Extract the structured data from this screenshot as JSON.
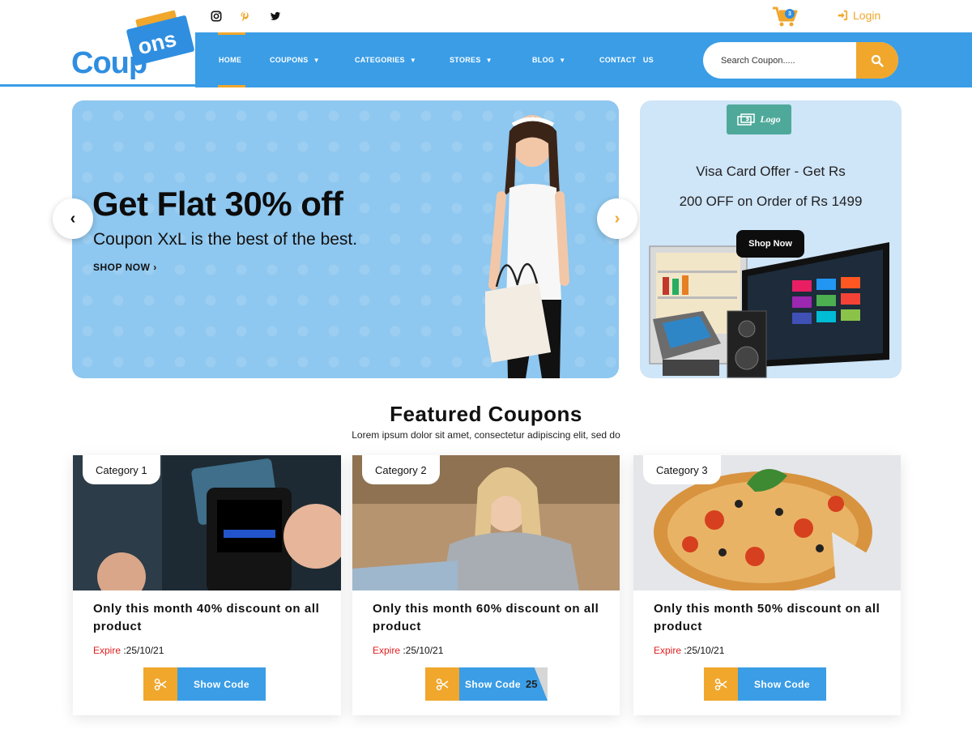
{
  "brand": {
    "logo_main": "Coup",
    "logo_accent": "ons"
  },
  "social": [
    {
      "name": "instagram-icon",
      "color": "#111111"
    },
    {
      "name": "pinterest-icon",
      "color": "#f0a72c"
    },
    {
      "name": "twitter-icon",
      "color": "#111111"
    }
  ],
  "header": {
    "cart_count": "3",
    "login_label": "Login"
  },
  "nav": {
    "items": [
      {
        "label": "HOME",
        "dropdown": false,
        "active": true
      },
      {
        "label": "COUPONS",
        "dropdown": true
      },
      {
        "label": "CATEGORIES",
        "dropdown": true
      },
      {
        "label": "STORES",
        "dropdown": true
      },
      {
        "label": "BLOG",
        "dropdown": true
      },
      {
        "label": "CONTACT   US",
        "dropdown": false
      }
    ]
  },
  "search": {
    "placeholder": "Search Coupon....."
  },
  "hero": {
    "title": "Get Flat 30% off",
    "subtitle": "Coupon XxL is the best of the best.",
    "cta": "SHOP NOW ›",
    "prev_arrow": "‹",
    "next_arrow": "›"
  },
  "offer": {
    "logo_text": "Logo",
    "line1": "Visa Card Offer - Get Rs",
    "line2": "200 OFF on Order of Rs 1499",
    "button": "Shop Now"
  },
  "featured": {
    "title": "Featured Coupons",
    "subtitle": "Lorem ipsum dolor sit amet, consectetur adipiscing elit, sed do"
  },
  "cards": [
    {
      "category": "Category 1",
      "title": "Only this month 40% discount on all product",
      "expire_label": "Expire",
      "expire_date": " :25/10/21",
      "button": "Show Code",
      "revealed": false
    },
    {
      "category": "Category 2",
      "title": "Only this month 60% discount on all product",
      "expire_label": "Expire",
      "expire_date": " :25/10/21",
      "button": "Show Code",
      "revealed": true,
      "code_peek": "25"
    },
    {
      "category": "Category 3",
      "title": "Only this month 50% discount on all product",
      "expire_label": "Expire",
      "expire_date": " :25/10/21",
      "button": "Show Code",
      "revealed": false
    }
  ],
  "colors": {
    "primary": "#3a9de6",
    "accent": "#f0a72c",
    "danger": "#e02020"
  }
}
